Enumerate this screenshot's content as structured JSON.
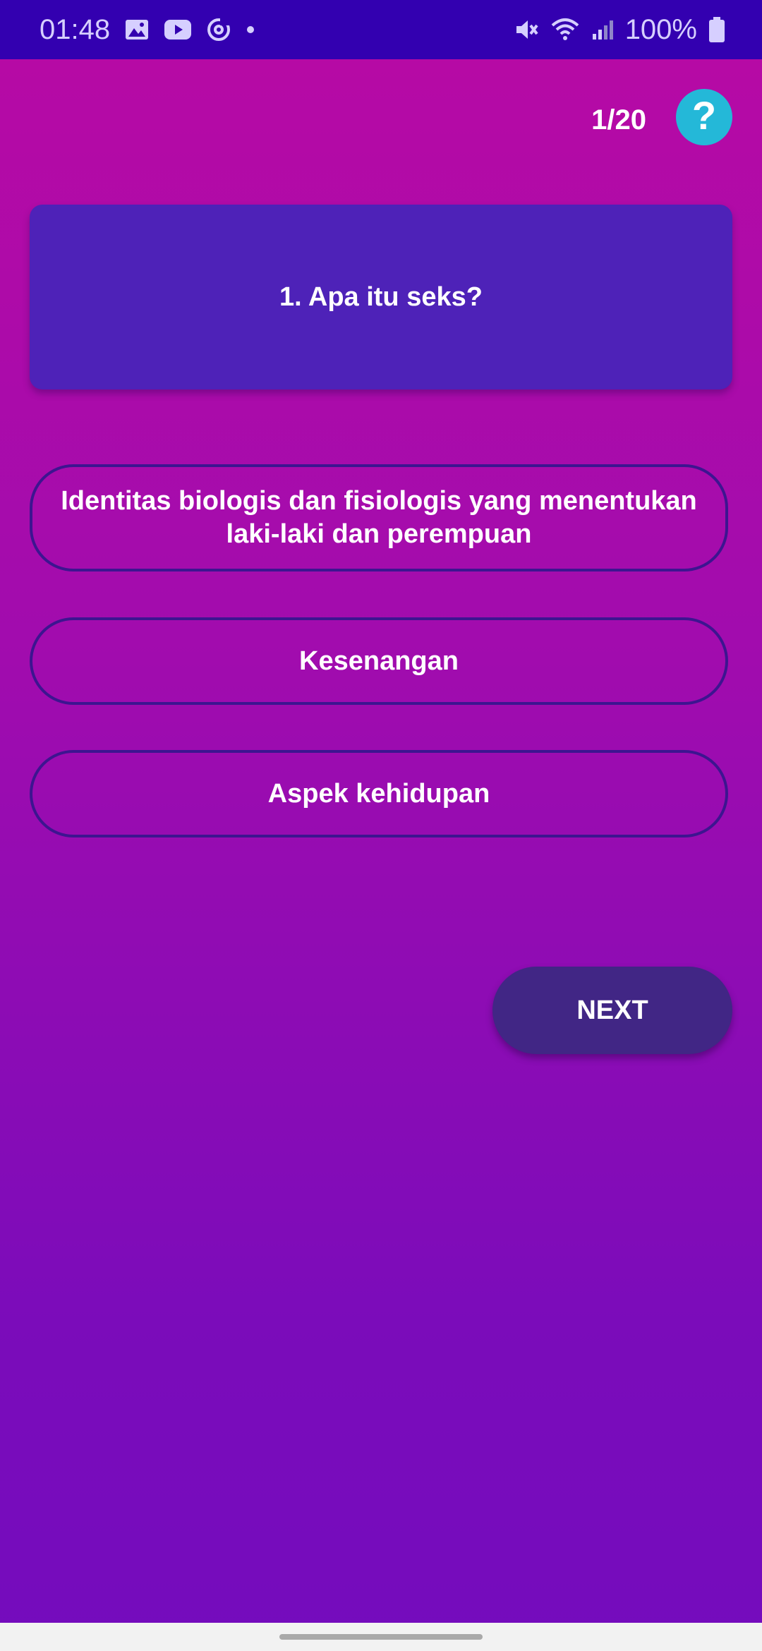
{
  "status_bar": {
    "time": "01:48",
    "left_icons": [
      "image-icon",
      "youtube-icon",
      "at-sign-icon",
      "dot-icon"
    ],
    "right_icons": [
      "mute-icon",
      "wifi-icon",
      "signal-icon",
      "battery-icon"
    ],
    "battery": "100%",
    "background_color": "#3300B0"
  },
  "header": {
    "progress": "1/20",
    "help_label": "?"
  },
  "question": {
    "text": "1. Apa itu seks?"
  },
  "options": [
    {
      "label": "Identitas biologis dan fisiologis yang menentukan laki-laki dan perempuan"
    },
    {
      "label": "Kesenangan"
    },
    {
      "label": "Aspek kehidupan"
    }
  ],
  "actions": {
    "next_label": "NEXT"
  },
  "colors": {
    "background_top": "#B80AA4",
    "background_bottom": "#740CBD",
    "question_card": "#4E22B8",
    "option_border": "#3D1590",
    "next_button": "#412685",
    "help_button": "#24B8D8"
  }
}
